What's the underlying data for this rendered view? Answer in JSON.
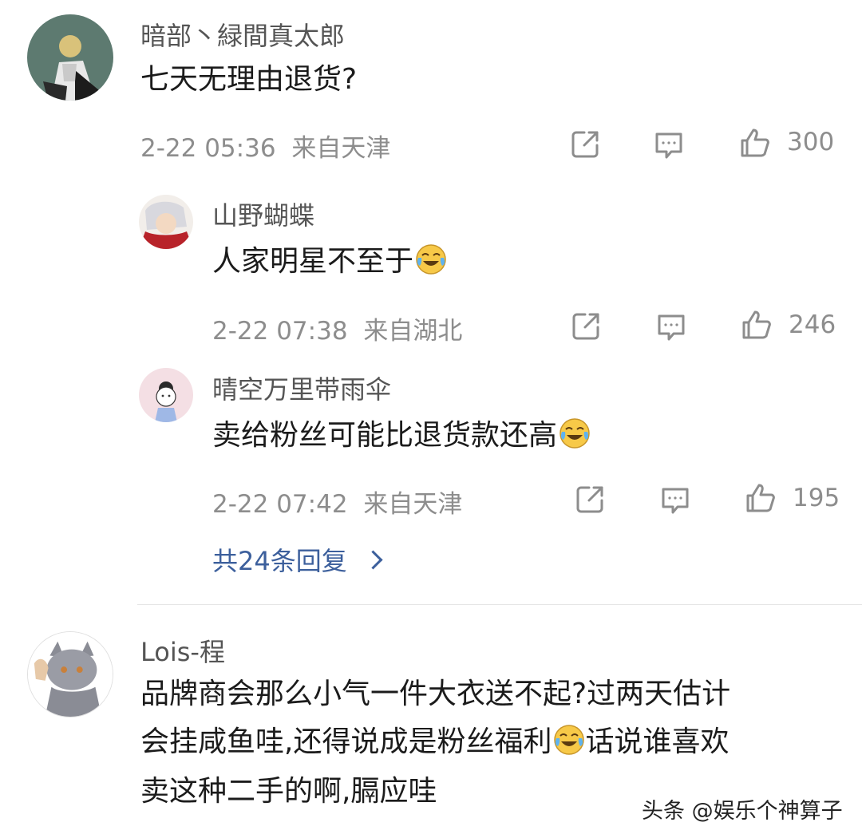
{
  "comments": [
    {
      "username": "暗部丶緑間真太郎",
      "text": "七天无理由退货?",
      "time": "2-22 05:36",
      "location": "来自天津",
      "likes": "300",
      "replies": [
        {
          "username": "山野蝴蝶",
          "text": "人家明星不至于",
          "time": "2-22 07:38",
          "location": "来自湖北",
          "likes": "246"
        },
        {
          "username": "晴空万里带雨伞",
          "text": "卖给粉丝可能比退货款还高",
          "time": "2-22 07:42",
          "location": "来自天津",
          "likes": "195"
        }
      ],
      "more_replies": "共24条回复"
    },
    {
      "username": "Lois-程",
      "text_lines": [
        "品牌商会那么小气一件大衣送不起?过两天估计",
        "会挂咸鱼哇,还得说成是粉丝福利",
        "卖这种二手的啊,膈应哇"
      ],
      "text_line2_suffix": "话说谁喜欢"
    }
  ],
  "icons": {
    "share": "share-icon",
    "comment": "comment-icon",
    "like": "thumbs-up-icon",
    "emoji": "laughing-tears-emoji"
  },
  "watermark": "头条 @娱乐个神算子",
  "colors": {
    "name": "#555555",
    "meta": "#8d8d8d",
    "link": "#3c5f9c"
  }
}
